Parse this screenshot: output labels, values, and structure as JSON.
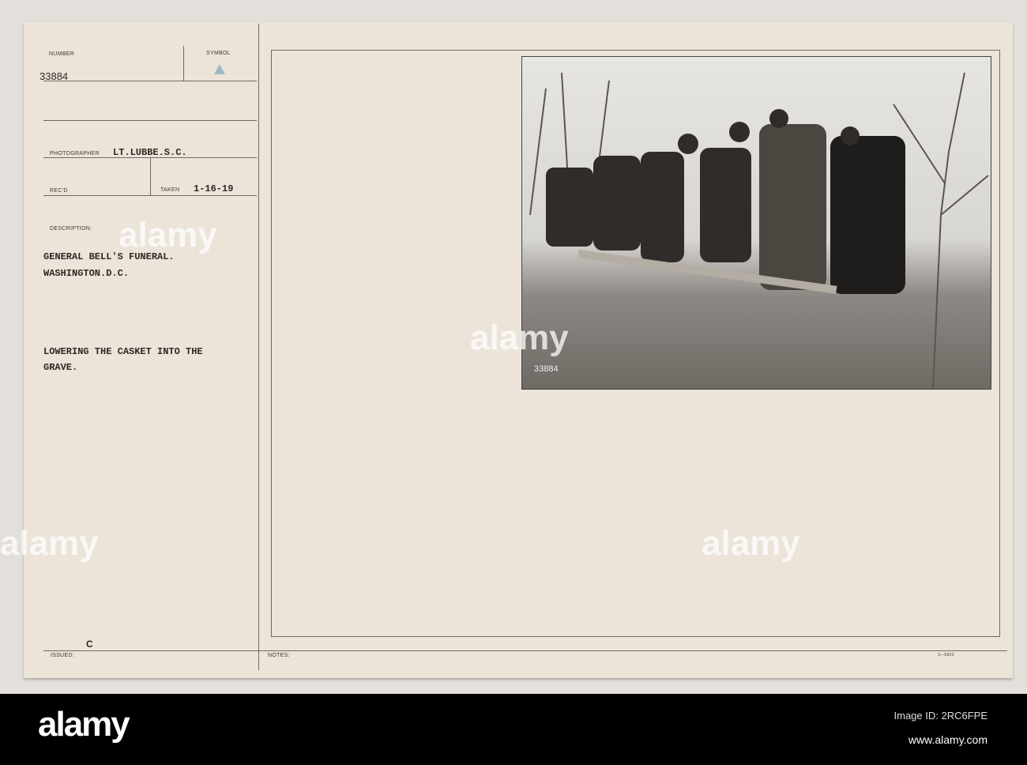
{
  "form": {
    "number_label": "NUMBER",
    "number": "33884",
    "symbol_label": "SYMBOL",
    "photographer_label": "PHOTOGRAPHER",
    "photographer": "LT.LUBBE.S.C.",
    "recd_label": "REC'D",
    "taken_label": "TAKEN",
    "taken": "1-16-19",
    "description_label": "DESCRIPTION:",
    "description_line1": "GENERAL BELL'S FUNERAL.",
    "description_line2": "WASHINGTON.D.C.",
    "caption_line1": "LOWERING THE CASKET INTO THE",
    "caption_line2": "GRAVE.",
    "issued_mark": "C",
    "issued_label": "ISSUED:",
    "notes_label": "NOTES:",
    "form_code": "3—5603"
  },
  "photo": {
    "negative_number": "33884"
  },
  "watermark": {
    "brand": "alamy",
    "image_id": "Image ID: 2RC6FPE",
    "url": "www.alamy.com"
  }
}
